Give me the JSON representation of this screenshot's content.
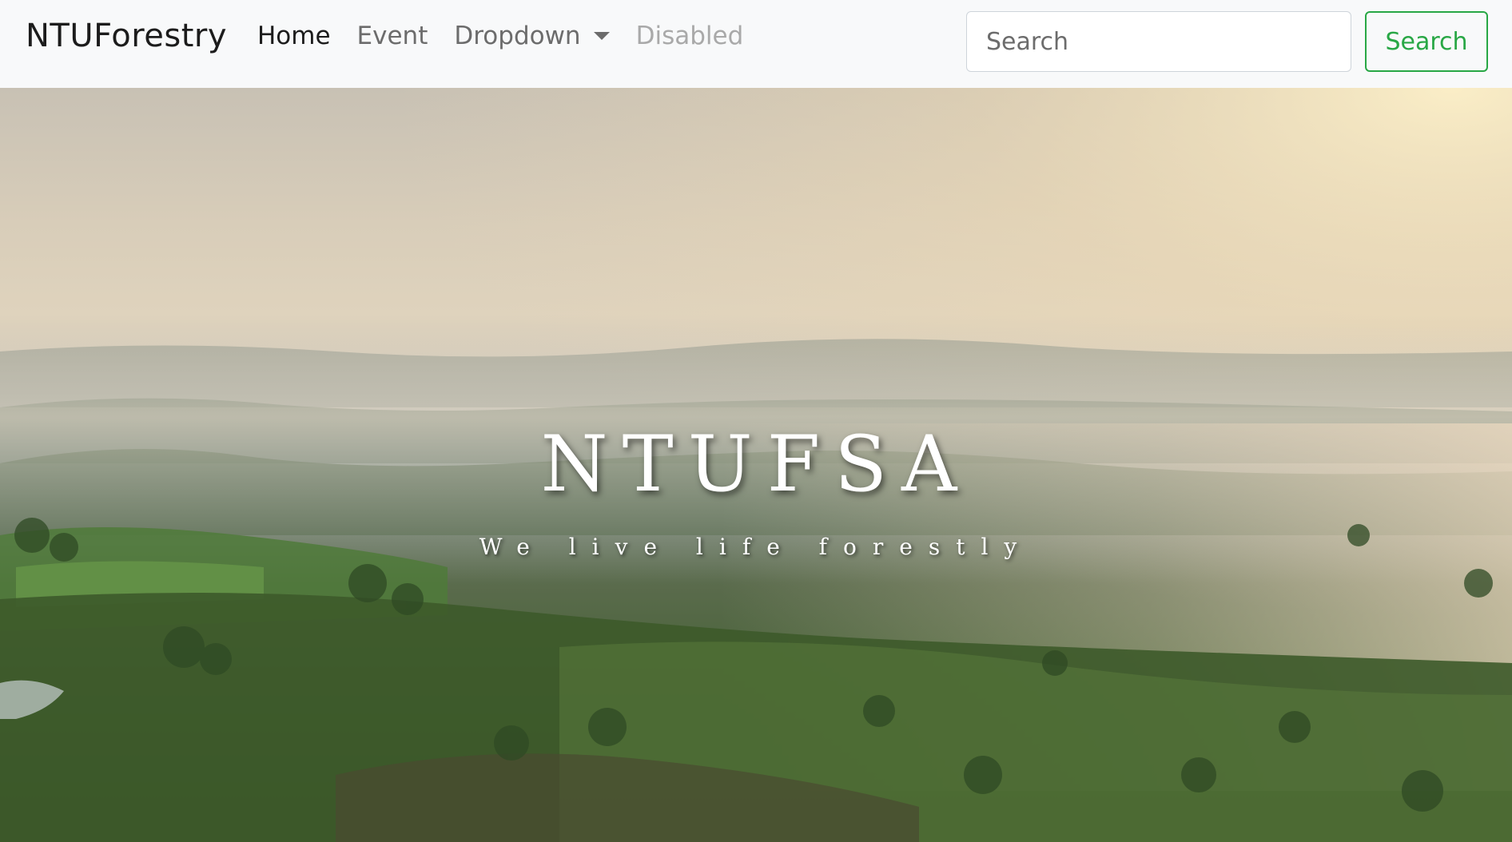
{
  "navbar": {
    "brand": "NTUForestry",
    "links": [
      {
        "label": "Home",
        "state": "active"
      },
      {
        "label": "Event",
        "state": "normal"
      },
      {
        "label": "Dropdown",
        "state": "dropdown"
      },
      {
        "label": "Disabled",
        "state": "disabled"
      }
    ],
    "search": {
      "placeholder": "Search",
      "button_label": "Search"
    }
  },
  "hero": {
    "title": "NTUFSA",
    "subtitle": "We live life forestly"
  },
  "colors": {
    "navbar_bg": "#f8f9fa",
    "search_accent": "#28a745",
    "hero_text": "#ffffff"
  }
}
